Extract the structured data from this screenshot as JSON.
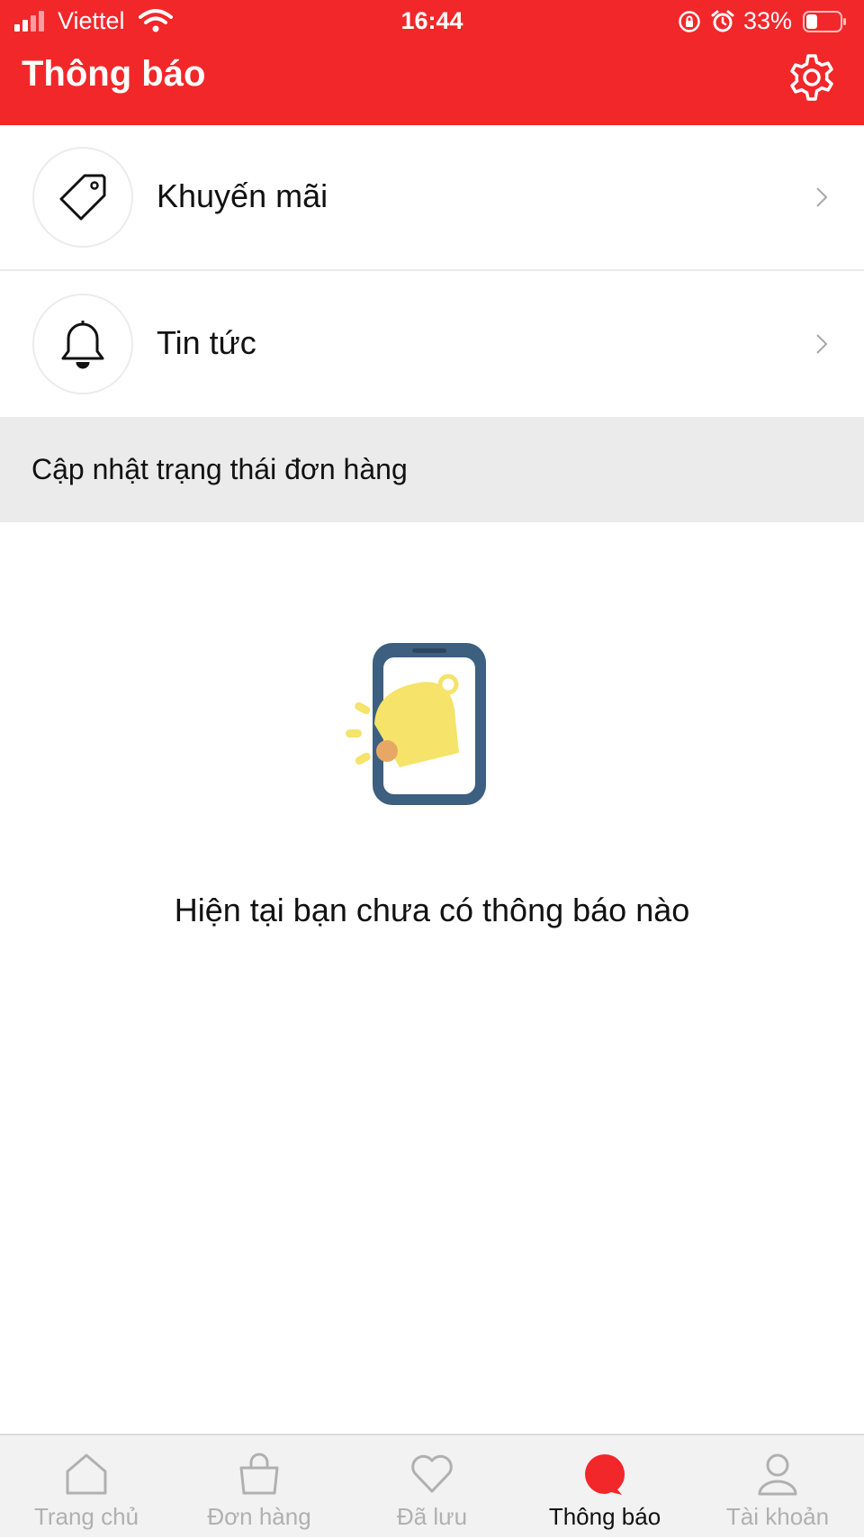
{
  "status_bar": {
    "carrier": "Viettel",
    "time": "16:44",
    "battery_percent": "33%",
    "battery_level": 0.33
  },
  "header": {
    "title": "Thông báo",
    "settings_icon": "gear-icon"
  },
  "menu": [
    {
      "label": "Khuyến mãi",
      "icon": "price-tag-icon"
    },
    {
      "label": "Tin tức",
      "icon": "bell-icon"
    }
  ],
  "section": {
    "title": "Cập nhật trạng thái đơn hàng"
  },
  "empty_state": {
    "message": "Hiện tại bạn chưa có thông báo nào",
    "illustration": "phone-bell-illustration"
  },
  "bottom_nav": {
    "items": [
      {
        "label": "Trang chủ",
        "icon": "home-icon",
        "active": false
      },
      {
        "label": "Đơn hàng",
        "icon": "shopping-bag-icon",
        "active": false
      },
      {
        "label": "Đã lưu",
        "icon": "heart-icon",
        "active": false
      },
      {
        "label": "Thông báo",
        "icon": "chat-bubble-icon",
        "active": true
      },
      {
        "label": "Tài khoản",
        "icon": "user-icon",
        "active": false
      }
    ]
  },
  "colors": {
    "brand": "#f2272a",
    "inactive_nav": "#b0b0b0",
    "section_bg": "#ebebeb"
  }
}
